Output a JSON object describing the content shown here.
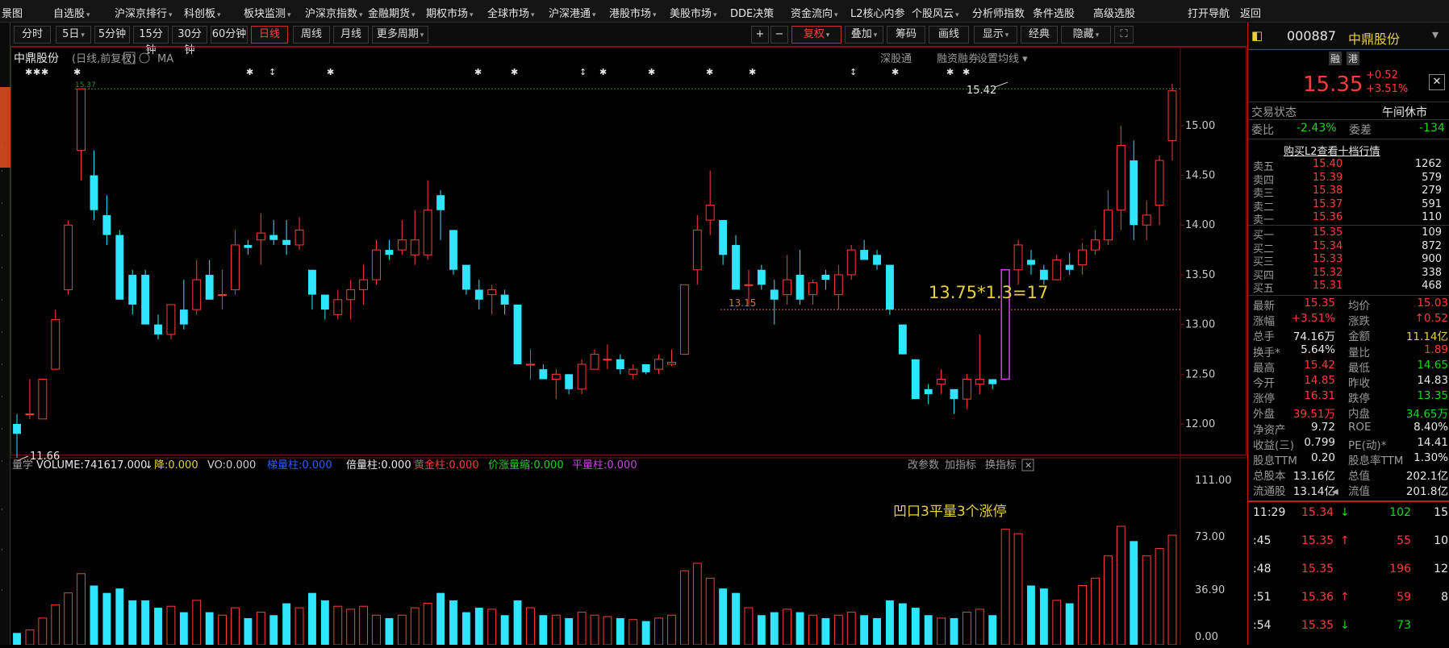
{
  "menu": [
    {
      "label": "自选股",
      "arrow": true
    },
    {
      "label": "沪深京排行",
      "arrow": true
    },
    {
      "label": "科创板",
      "arrow": true
    },
    {
      "label": "板块监测",
      "arrow": true
    },
    {
      "label": "沪深京指数",
      "arrow": true
    },
    {
      "label": "金融期货",
      "arrow": true
    },
    {
      "label": "期权市场",
      "arrow": true
    },
    {
      "label": "全球市场",
      "arrow": true
    },
    {
      "label": "沪深港通",
      "arrow": true
    },
    {
      "label": "港股市场",
      "arrow": true
    },
    {
      "label": "美股市场",
      "arrow": true
    },
    {
      "label": "DDE决策",
      "arrow": false
    },
    {
      "label": "资金流向",
      "arrow": true
    },
    {
      "label": "L2核心内参",
      "arrow": false
    },
    {
      "label": "个股风云",
      "arrow": true
    },
    {
      "label": "分析师指数",
      "arrow": false
    },
    {
      "label": "条件选股",
      "arrow": false
    },
    {
      "label": "高级选股",
      "arrow": false
    },
    {
      "label": "打开导航",
      "arrow": false
    },
    {
      "label": "返回",
      "arrow": false
    }
  ],
  "menu_left_fragment": "景图",
  "toolbar": {
    "periods": [
      "分时",
      "5日",
      "5分钟",
      "15分钟",
      "30分钟",
      "60分钟",
      "日线",
      "周线",
      "月线",
      "更多周期"
    ],
    "active_period": "日线",
    "plus": "+",
    "minus": "−",
    "right_buttons": [
      "复权",
      "叠加",
      "筹码",
      "画线",
      "显示",
      "经典",
      "隐藏"
    ],
    "fq_label": "复权"
  },
  "stock": {
    "code": "000887",
    "name": "中鼎股份",
    "tag1": "融",
    "tag2": "港",
    "price": "15.35",
    "change": "+0.52",
    "change_pct": "+3.51%"
  },
  "chart_header": {
    "name": "中鼎股份",
    "desc": "(日线,前复权)",
    "help": "?",
    "ma": "MA",
    "links": [
      "深股通",
      "融资融券",
      "设置均线"
    ]
  },
  "annotations": {
    "low": "11.66",
    "high": "15.42",
    "hline_label": "13.15",
    "formula": "13.75*1.3=17",
    "vol_text": "凹口3平量3个涨停",
    "peak_small": "15.37"
  },
  "y_ticks": [
    "15.00",
    "14.50",
    "14.00",
    "13.50",
    "13.00",
    "12.50",
    "12.00"
  ],
  "volume_header": {
    "prefix": "量学",
    "volume": "VOLUME:741617.000",
    "arrow": "↓",
    "items": [
      {
        "label": "降:0.000",
        "color": "#e8d03a"
      },
      {
        "label": "VO:0.000",
        "color": "#cfcfcf"
      },
      {
        "label": "梯量柱:0.000",
        "color": "#2d5cff"
      },
      {
        "label": "倍量柱:0.000",
        "color": "#e8e8e8"
      },
      {
        "label": "黄金柱:0.000",
        "color": "#ff3b3b"
      },
      {
        "label": "价涨量缩:0.000",
        "color": "#19d419"
      },
      {
        "label": "平量柱:0.000",
        "color": "#d040e8"
      }
    ],
    "links": [
      "改参数",
      "加指标",
      "换指标"
    ]
  },
  "vol_ticks": [
    "111.00",
    "73.00",
    "36.90",
    "0.00"
  ],
  "chart_data": {
    "type": "candlestick",
    "ylim": [
      11.7,
      15.55
    ],
    "volume_ylim": [
      0,
      111
    ],
    "candles": [
      {
        "o": 12.0,
        "h": 12.1,
        "l": 11.66,
        "c": 11.9,
        "v": 8
      },
      {
        "o": 12.1,
        "h": 12.45,
        "l": 12.05,
        "c": 12.1,
        "v": 10
      },
      {
        "o": 12.05,
        "h": 12.45,
        "l": 12.05,
        "c": 12.45,
        "v": 18
      },
      {
        "o": 12.55,
        "h": 13.15,
        "l": 12.55,
        "c": 13.05,
        "v": 27
      },
      {
        "o": 13.35,
        "h": 14.05,
        "l": 13.3,
        "c": 14.0,
        "v": 35
      },
      {
        "o": 14.75,
        "h": 15.37,
        "l": 14.45,
        "c": 15.37,
        "v": 48
      },
      {
        "o": 14.5,
        "h": 14.75,
        "l": 14.05,
        "c": 14.15,
        "v": 40
      },
      {
        "o": 14.1,
        "h": 14.3,
        "l": 13.8,
        "c": 13.9,
        "v": 35
      },
      {
        "o": 13.9,
        "h": 13.95,
        "l": 13.25,
        "c": 13.25,
        "v": 38
      },
      {
        "o": 13.5,
        "h": 13.55,
        "l": 13.1,
        "c": 13.2,
        "v": 30
      },
      {
        "o": 13.5,
        "h": 13.55,
        "l": 13.0,
        "c": 13.0,
        "v": 30
      },
      {
        "o": 13.0,
        "h": 13.1,
        "l": 12.85,
        "c": 12.9,
        "v": 25
      },
      {
        "o": 12.9,
        "h": 13.2,
        "l": 12.85,
        "c": 13.2,
        "v": 26
      },
      {
        "o": 13.15,
        "h": 13.45,
        "l": 12.95,
        "c": 13.0,
        "v": 22
      },
      {
        "o": 13.15,
        "h": 13.65,
        "l": 13.1,
        "c": 13.45,
        "v": 30
      },
      {
        "o": 13.5,
        "h": 13.65,
        "l": 13.3,
        "c": 13.25,
        "v": 22
      },
      {
        "o": 13.3,
        "h": 13.55,
        "l": 13.15,
        "c": 13.3,
        "v": 20
      },
      {
        "o": 13.35,
        "h": 13.95,
        "l": 13.3,
        "c": 13.8,
        "v": 25
      },
      {
        "o": 13.8,
        "h": 13.85,
        "l": 13.7,
        "c": 13.77,
        "v": 18
      },
      {
        "o": 13.85,
        "h": 14.12,
        "l": 13.6,
        "c": 13.92,
        "v": 22
      },
      {
        "o": 13.9,
        "h": 14.05,
        "l": 13.8,
        "c": 13.85,
        "v": 20
      },
      {
        "o": 13.85,
        "h": 14.05,
        "l": 13.7,
        "c": 13.8,
        "v": 28
      },
      {
        "o": 13.8,
        "h": 14.08,
        "l": 13.75,
        "c": 13.95,
        "v": 25
      },
      {
        "o": 13.55,
        "h": 13.55,
        "l": 13.15,
        "c": 13.3,
        "v": 35
      },
      {
        "o": 13.3,
        "h": 13.3,
        "l": 13.05,
        "c": 13.15,
        "v": 30
      },
      {
        "o": 13.1,
        "h": 13.35,
        "l": 13.05,
        "c": 13.25,
        "v": 26
      },
      {
        "o": 13.25,
        "h": 13.45,
        "l": 13.05,
        "c": 13.35,
        "v": 24
      },
      {
        "o": 13.35,
        "h": 13.6,
        "l": 13.2,
        "c": 13.45,
        "v": 26
      },
      {
        "o": 13.45,
        "h": 13.85,
        "l": 13.4,
        "c": 13.75,
        "v": 20
      },
      {
        "o": 13.75,
        "h": 13.85,
        "l": 13.65,
        "c": 13.7,
        "v": 18
      },
      {
        "o": 13.75,
        "h": 14.05,
        "l": 13.7,
        "c": 13.85,
        "v": 20
      },
      {
        "o": 13.7,
        "h": 14.15,
        "l": 13.6,
        "c": 13.85,
        "v": 25
      },
      {
        "o": 13.7,
        "h": 14.45,
        "l": 13.65,
        "c": 14.15,
        "v": 28
      },
      {
        "o": 14.3,
        "h": 14.35,
        "l": 13.85,
        "c": 14.15,
        "v": 35
      },
      {
        "o": 13.95,
        "h": 13.95,
        "l": 13.5,
        "c": 13.55,
        "v": 30
      },
      {
        "o": 13.6,
        "h": 13.6,
        "l": 13.3,
        "c": 13.35,
        "v": 22
      },
      {
        "o": 13.35,
        "h": 13.45,
        "l": 13.15,
        "c": 13.25,
        "v": 25
      },
      {
        "o": 13.3,
        "h": 13.4,
        "l": 13.1,
        "c": 13.35,
        "v": 24
      },
      {
        "o": 13.3,
        "h": 13.35,
        "l": 13.1,
        "c": 13.2,
        "v": 20
      },
      {
        "o": 13.2,
        "h": 13.2,
        "l": 12.6,
        "c": 12.6,
        "v": 30
      },
      {
        "o": 12.6,
        "h": 12.75,
        "l": 12.45,
        "c": 12.6,
        "v": 25
      },
      {
        "o": 12.55,
        "h": 12.6,
        "l": 12.45,
        "c": 12.45,
        "v": 20
      },
      {
        "o": 12.45,
        "h": 12.55,
        "l": 12.25,
        "c": 12.5,
        "v": 20
      },
      {
        "o": 12.5,
        "h": 12.5,
        "l": 12.3,
        "c": 12.35,
        "v": 18
      },
      {
        "o": 12.35,
        "h": 12.65,
        "l": 12.3,
        "c": 12.6,
        "v": 22
      },
      {
        "o": 12.55,
        "h": 12.75,
        "l": 12.55,
        "c": 12.7,
        "v": 20
      },
      {
        "o": 12.65,
        "h": 12.8,
        "l": 12.55,
        "c": 12.65,
        "v": 19
      },
      {
        "o": 12.65,
        "h": 12.7,
        "l": 12.5,
        "c": 12.55,
        "v": 18
      },
      {
        "o": 12.5,
        "h": 12.6,
        "l": 12.45,
        "c": 12.55,
        "v": 17
      },
      {
        "o": 12.6,
        "h": 12.6,
        "l": 12.5,
        "c": 12.52,
        "v": 16
      },
      {
        "o": 12.55,
        "h": 12.7,
        "l": 12.5,
        "c": 12.65,
        "v": 18
      },
      {
        "o": 12.6,
        "h": 12.75,
        "l": 12.58,
        "c": 12.62,
        "v": 20
      },
      {
        "o": 12.7,
        "h": 13.35,
        "l": 12.7,
        "c": 13.4,
        "v": 50
      },
      {
        "o": 13.55,
        "h": 14.1,
        "l": 13.4,
        "c": 13.95,
        "v": 55
      },
      {
        "o": 14.05,
        "h": 14.55,
        "l": 13.9,
        "c": 14.2,
        "v": 45
      },
      {
        "o": 14.05,
        "h": 14.05,
        "l": 13.6,
        "c": 13.7,
        "v": 38
      },
      {
        "o": 13.8,
        "h": 13.9,
        "l": 13.35,
        "c": 13.35,
        "v": 35
      },
      {
        "o": 13.4,
        "h": 13.55,
        "l": 13.2,
        "c": 13.4,
        "v": 25
      },
      {
        "o": 13.55,
        "h": 13.6,
        "l": 13.35,
        "c": 13.4,
        "v": 20
      },
      {
        "o": 13.35,
        "h": 13.45,
        "l": 13.0,
        "c": 13.25,
        "v": 22
      },
      {
        "o": 13.3,
        "h": 13.7,
        "l": 13.2,
        "c": 13.45,
        "v": 24
      },
      {
        "o": 13.5,
        "h": 13.75,
        "l": 13.2,
        "c": 13.25,
        "v": 22
      },
      {
        "o": 13.3,
        "h": 13.45,
        "l": 13.2,
        "c": 13.42,
        "v": 20
      },
      {
        "o": 13.5,
        "h": 13.55,
        "l": 13.35,
        "c": 13.45,
        "v": 18
      },
      {
        "o": 13.3,
        "h": 13.6,
        "l": 13.15,
        "c": 13.5,
        "v": 20
      },
      {
        "o": 13.5,
        "h": 13.8,
        "l": 13.45,
        "c": 13.75,
        "v": 22
      },
      {
        "o": 13.75,
        "h": 13.85,
        "l": 13.65,
        "c": 13.65,
        "v": 20
      },
      {
        "o": 13.7,
        "h": 13.75,
        "l": 13.55,
        "c": 13.6,
        "v": 18
      },
      {
        "o": 13.6,
        "h": 13.6,
        "l": 13.1,
        "c": 13.15,
        "v": 30
      },
      {
        "o": 13.0,
        "h": 13.0,
        "l": 12.7,
        "c": 12.7,
        "v": 28
      },
      {
        "o": 12.65,
        "h": 12.65,
        "l": 12.25,
        "c": 12.25,
        "v": 25
      },
      {
        "o": 12.35,
        "h": 12.4,
        "l": 12.2,
        "c": 12.3,
        "v": 20
      },
      {
        "o": 12.4,
        "h": 12.55,
        "l": 12.3,
        "c": 12.45,
        "v": 18
      },
      {
        "o": 12.35,
        "h": 12.35,
        "l": 12.1,
        "c": 12.25,
        "v": 18
      },
      {
        "o": 12.25,
        "h": 12.5,
        "l": 12.15,
        "c": 12.45,
        "v": 22
      },
      {
        "o": 12.4,
        "h": 12.9,
        "l": 12.3,
        "c": 12.45,
        "v": 24
      },
      {
        "o": 12.45,
        "h": 12.45,
        "l": 12.35,
        "c": 12.4,
        "v": 20
      },
      {
        "o": 12.45,
        "h": 13.55,
        "l": 12.45,
        "c": 13.55,
        "v": 78
      },
      {
        "o": 13.55,
        "h": 13.85,
        "l": 13.4,
        "c": 13.8,
        "v": 75
      },
      {
        "o": 13.65,
        "h": 13.75,
        "l": 13.5,
        "c": 13.6,
        "v": 40
      },
      {
        "o": 13.55,
        "h": 13.6,
        "l": 13.4,
        "c": 13.45,
        "v": 38
      },
      {
        "o": 13.45,
        "h": 13.7,
        "l": 13.45,
        "c": 13.65,
        "v": 30
      },
      {
        "o": 13.6,
        "h": 13.72,
        "l": 13.5,
        "c": 13.55,
        "v": 28
      },
      {
        "o": 13.6,
        "h": 13.82,
        "l": 13.5,
        "c": 13.75,
        "v": 40
      },
      {
        "o": 13.75,
        "h": 13.95,
        "l": 13.7,
        "c": 13.85,
        "v": 45
      },
      {
        "o": 13.85,
        "h": 14.35,
        "l": 13.8,
        "c": 14.15,
        "v": 60
      },
      {
        "o": 14.15,
        "h": 15.0,
        "l": 13.95,
        "c": 14.8,
        "v": 80
      },
      {
        "o": 14.65,
        "h": 14.85,
        "l": 13.85,
        "c": 14.0,
        "v": 70
      },
      {
        "o": 14.0,
        "h": 14.25,
        "l": 13.85,
        "c": 14.1,
        "v": 60
      },
      {
        "o": 14.2,
        "h": 14.7,
        "l": 14.0,
        "c": 14.65,
        "v": 65
      },
      {
        "o": 14.85,
        "h": 15.42,
        "l": 14.65,
        "c": 15.35,
        "v": 74
      }
    ]
  },
  "quote": {
    "trade_status_label": "交易状态",
    "trade_status": "午间休市",
    "wb_label": "委比",
    "wb": "-2.43%",
    "wc_label": "委差",
    "wc": "-134",
    "l2_link": "购买L2查看十档行情",
    "asks": [
      {
        "label": "卖五",
        "price": "15.40",
        "vol": "1262"
      },
      {
        "label": "卖四",
        "price": "15.39",
        "vol": "579"
      },
      {
        "label": "卖三",
        "price": "15.38",
        "vol": "279"
      },
      {
        "label": "卖二",
        "price": "15.37",
        "vol": "591"
      },
      {
        "label": "卖一",
        "price": "15.36",
        "vol": "110"
      }
    ],
    "bids": [
      {
        "label": "买一",
        "price": "15.35",
        "vol": "109"
      },
      {
        "label": "买二",
        "price": "15.34",
        "vol": "872"
      },
      {
        "label": "买三",
        "price": "15.33",
        "vol": "900"
      },
      {
        "label": "买四",
        "price": "15.32",
        "vol": "338"
      },
      {
        "label": "买五",
        "price": "15.31",
        "vol": "468"
      }
    ],
    "stats": [
      [
        "最新",
        "15.35",
        "red",
        "均价",
        "15.03",
        "red"
      ],
      [
        "涨幅",
        "+3.51%",
        "red",
        "涨跌",
        "↑0.52",
        "red"
      ],
      [
        "总手",
        "74.16万",
        "white",
        "金额",
        "11.14亿",
        "yellow"
      ],
      [
        "换手*",
        "5.64%",
        "white",
        "量比",
        "1.89",
        "red"
      ],
      [
        "最高",
        "15.42",
        "red",
        "最低",
        "14.65",
        "green"
      ],
      [
        "今开",
        "14.85",
        "red",
        "昨收",
        "14.83",
        "white"
      ],
      [
        "涨停",
        "16.31",
        "red",
        "跌停",
        "13.35",
        "green"
      ],
      [
        "外盘",
        "39.51万",
        "red",
        "内盘",
        "34.65万",
        "green"
      ],
      [
        "净资产",
        "9.72",
        "white",
        "ROE",
        "8.40%",
        "white"
      ],
      [
        "收益(三)",
        "0.799",
        "white",
        "PE(动)*",
        "14.41",
        "white"
      ],
      [
        "股息TTM",
        "0.20",
        "white",
        "股息率TTM",
        "1.30%",
        "white"
      ],
      [
        "总股本",
        "13.16亿",
        "white",
        "总值",
        "202.1亿",
        "white"
      ],
      [
        "流通股",
        "13.14亿",
        "white",
        "流值",
        "201.8亿",
        "white"
      ]
    ],
    "ticks": [
      {
        "time": "11:29",
        "price": "15.34",
        "arrow": "↓",
        "acolor": "green",
        "vol": "102",
        "vcolor": "green",
        "extra": "15"
      },
      {
        "time": ":45",
        "price": "15.35",
        "arrow": "↑",
        "acolor": "red",
        "vol": "55",
        "vcolor": "red",
        "extra": "10"
      },
      {
        "time": ":48",
        "price": "15.35",
        "arrow": "",
        "acolor": "red",
        "vol": "196",
        "vcolor": "red",
        "extra": "12"
      },
      {
        "time": ":51",
        "price": "15.36",
        "arrow": "↑",
        "acolor": "red",
        "vol": "59",
        "vcolor": "red",
        "extra": "8"
      },
      {
        "time": ":54",
        "price": "15.35",
        "arrow": "↓",
        "acolor": "green",
        "vol": "73",
        "vcolor": "green",
        "extra": ""
      }
    ]
  }
}
